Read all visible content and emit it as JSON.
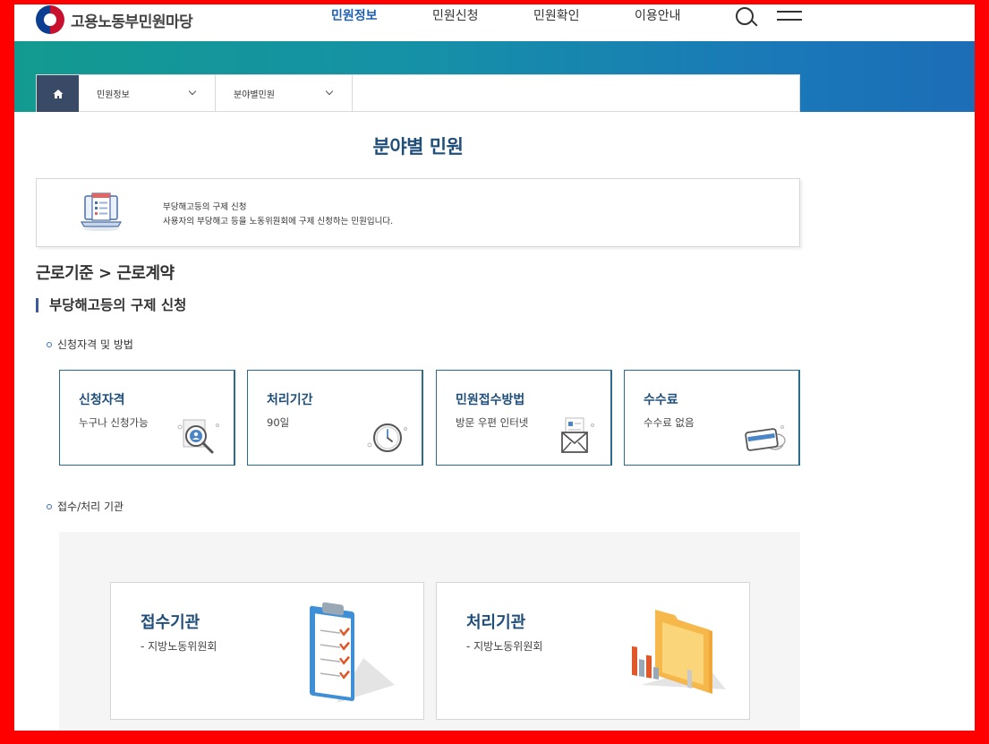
{
  "header": {
    "logo_text": "고용노동부민원마당",
    "nav": [
      {
        "label": "민원정보",
        "active": true
      },
      {
        "label": "민원신청",
        "active": false
      },
      {
        "label": "민원확인",
        "active": false
      },
      {
        "label": "이용안내",
        "active": false
      }
    ],
    "icons": {
      "search": "search-icon",
      "menu": "hamburger-menu-icon"
    }
  },
  "breadcrumb": {
    "home_icon": "home-icon",
    "items": [
      "민원정보",
      "분야별민원"
    ]
  },
  "page_title": "분야별 민원",
  "summary": {
    "title": "부당해고등의 구제 신청",
    "description": "사용자의 부당해고 등을 노동위원회에 구제 신청하는 민원입니다."
  },
  "category": "근로기준 > 근로계약",
  "section_title": "부당해고등의 구제 신청",
  "subsections": {
    "qualification": "신청자격 및 방법",
    "agency": "접수/처리 기관"
  },
  "cards": [
    {
      "title": "신청자격",
      "value": "누구나 신청가능",
      "icon": "magnifier-person-icon"
    },
    {
      "title": "처리기간",
      "value": "90일",
      "icon": "clock-icon"
    },
    {
      "title": "민원접수방법",
      "value": "방문 우편 인터넷",
      "icon": "envelope-icon"
    },
    {
      "title": "수수료",
      "value": "수수료 없음",
      "icon": "card-coin-icon"
    }
  ],
  "agencies": [
    {
      "title": "접수기관",
      "value": "- 지방노동위원회",
      "icon": "clipboard-icon"
    },
    {
      "title": "처리기관",
      "value": "- 지방노동위원회",
      "icon": "folder-chart-icon"
    }
  ],
  "colors": {
    "frame": "#ff0000",
    "accent": "#1f4e79",
    "banner_start": "#139a90",
    "banner_end": "#1c6db6",
    "breadcrumb_home": "#394a66"
  }
}
